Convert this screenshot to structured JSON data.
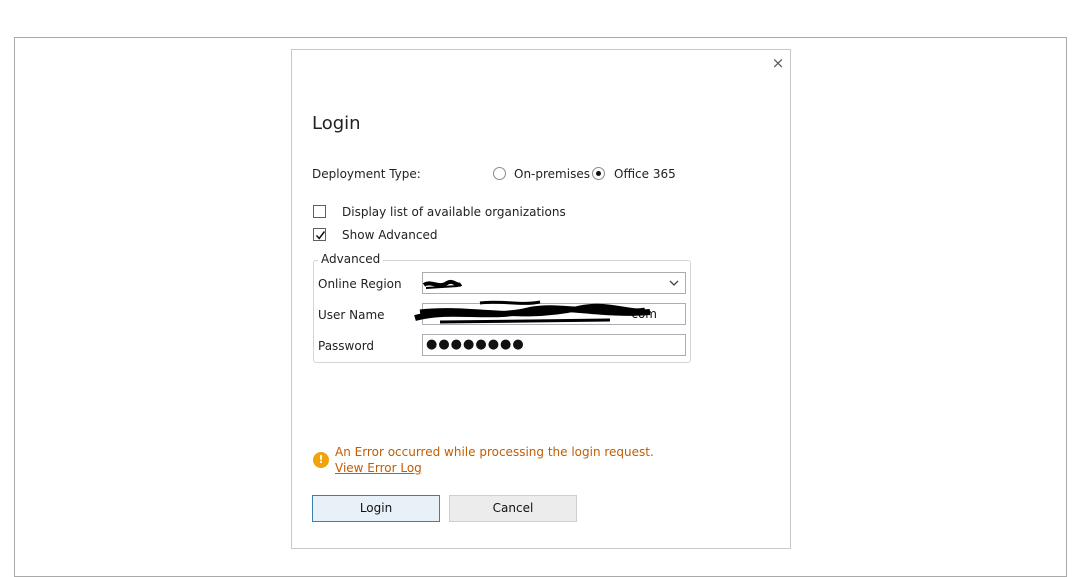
{
  "dialog": {
    "close_label": "×",
    "title": "Login",
    "deployment_label": "Deployment Type:",
    "deployment_options": [
      {
        "label": "On-premises",
        "selected": false
      },
      {
        "label": "Office 365",
        "selected": true
      }
    ],
    "display_orgs": {
      "label": "Display list of available organizations",
      "checked": false
    },
    "show_advanced": {
      "label": "Show Advanced",
      "checked": true
    },
    "advanced": {
      "legend": "Advanced",
      "online_region_label": "Online Region",
      "online_region_value": "",
      "user_name_label": "User Name",
      "user_name_value": "com",
      "password_label": "Password",
      "password_value": "●●●●●●●●"
    },
    "error": {
      "icon_glyph": "!",
      "message": "An Error occurred while processing the login request.",
      "link": "View Error Log"
    },
    "buttons": {
      "login": "Login",
      "cancel": "Cancel"
    }
  },
  "colors": {
    "error_text": "#c45c00",
    "error_icon": "#f0a30a",
    "login_border": "#3c7fb1"
  }
}
